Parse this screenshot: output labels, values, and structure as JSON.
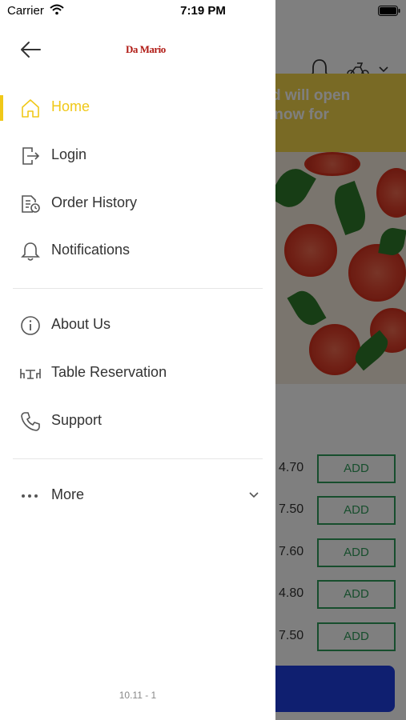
{
  "status_bar": {
    "carrier": "Carrier",
    "time": "7:19 PM"
  },
  "drawer": {
    "logo_text": "Da Mario",
    "menu_main": [
      {
        "label": "Home",
        "icon": "home-icon",
        "active": true
      },
      {
        "label": "Login",
        "icon": "login-icon",
        "active": false
      },
      {
        "label": "Order History",
        "icon": "order-history-icon",
        "active": false
      },
      {
        "label": "Notifications",
        "icon": "bell-icon",
        "active": false
      }
    ],
    "menu_secondary": [
      {
        "label": "About Us",
        "icon": "info-icon"
      },
      {
        "label": "Table Reservation",
        "icon": "table-icon"
      },
      {
        "label": "Support",
        "icon": "phone-icon"
      }
    ],
    "more_label": "More",
    "version": "10.11 - 1",
    "accent_color": "#f0c818"
  },
  "background": {
    "banner_text": "d and will open\nrder now for",
    "items": [
      {
        "price": "4.70",
        "button": "ADD"
      },
      {
        "price": "7.50",
        "button": "ADD"
      },
      {
        "price": "7.60",
        "button": "ADD"
      },
      {
        "price": "4.80",
        "button": "ADD"
      },
      {
        "price": "7.50",
        "button": "ADD"
      }
    ],
    "banner_color": "#f3d44a",
    "add_button_color": "#2e9c5a",
    "cta_color": "#1f3fe0"
  }
}
